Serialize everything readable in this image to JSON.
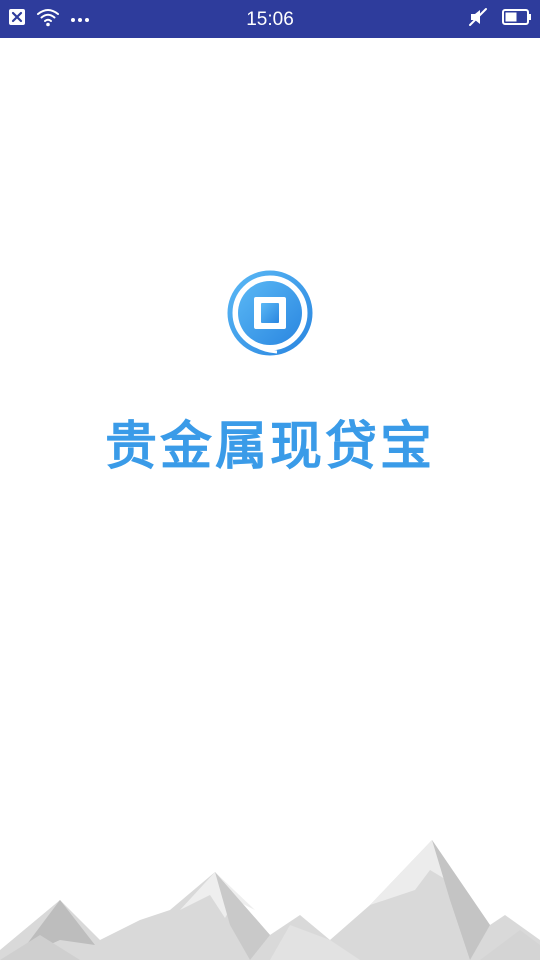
{
  "status_bar": {
    "time": "15:06",
    "background_color": "#2e3c9c",
    "left_icons": [
      "notification-close-icon",
      "wifi-icon",
      "more-dots-icon"
    ],
    "right_icons": [
      "mute-icon",
      "battery-icon"
    ]
  },
  "splash": {
    "brand_name": "贵金属现贷宝",
    "brand_color": "#3a9be8",
    "logo_icon": "app-logo-icon"
  },
  "decoration": {
    "footer_graphic": "mountains-graphic"
  }
}
